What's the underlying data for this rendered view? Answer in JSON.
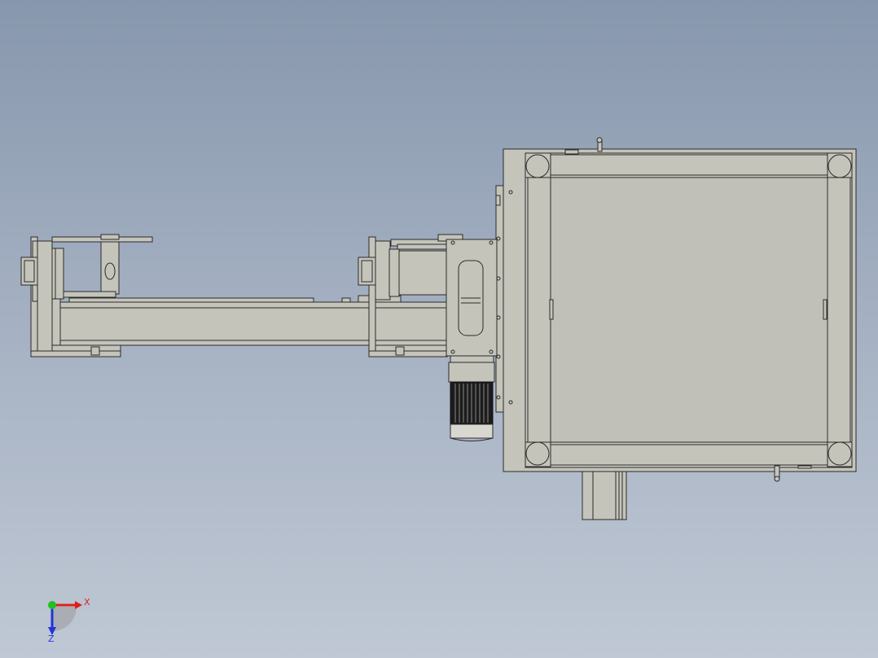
{
  "colors": {
    "background_top": "#8797ad",
    "background_bottom": "#bfc8d4",
    "part_fill": "#c4c4bb",
    "part_edge": "#2b2b2b",
    "axis_x": "#e01e1e",
    "axis_y": "#1fc21f",
    "axis_z": "#2233dd"
  },
  "triad": {
    "x_label": "X",
    "z_label": "Z"
  }
}
